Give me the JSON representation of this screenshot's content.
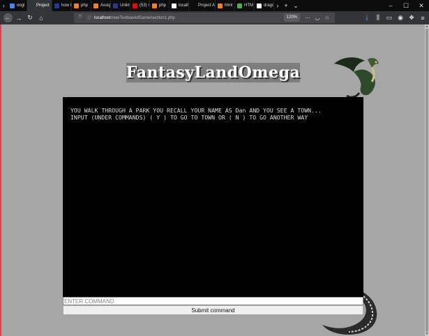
{
  "browser": {
    "tabs": [
      {
        "label": "oogl",
        "favicon_color": "#4285f4",
        "active": false
      },
      {
        "label": "Project",
        "favicon_color": "#323639",
        "active": true
      },
      {
        "label": "how t",
        "favicon_color": "#1f3a93",
        "active": false
      },
      {
        "label": "php",
        "favicon_color": "#f48024",
        "active": false
      },
      {
        "label": "Assig",
        "favicon_color": "#f48024",
        "active": false
      },
      {
        "label": "Unlim",
        "favicon_color": "#2a3b8f",
        "active": false
      },
      {
        "label": "(53) s",
        "favicon_color": "#ff0000",
        "active": false
      },
      {
        "label": "php",
        "favicon_color": "#f48024",
        "active": false
      },
      {
        "label": "localh",
        "favicon_color": "#ffffff",
        "active": false
      },
      {
        "label": "Project Ap",
        "favicon_color": "#0c0c0d",
        "active": false
      },
      {
        "label": "html",
        "favicon_color": "#f48024",
        "active": false
      },
      {
        "label": "HTM",
        "favicon_color": "#4caf50",
        "active": false
      },
      {
        "label": "drago",
        "favicon_color": "#ffffff",
        "active": false
      }
    ],
    "new_tab_icon": "plus-icon",
    "url_host": "localhost",
    "url_path": "/newTextbasedGame/section1.php",
    "zoom": "120%"
  },
  "page": {
    "site_title": "FantasyLandOmega",
    "game_lines": [
      "YOU WALK THROUGH A PARK YOU RECALL YOUR NAME AS Dan AND YOU SEE A TOWN...",
      "INPUT (UNDER COMMANDS) ( Y ) TO GO TO TOWN OR ( N ) TO GO ANOTHER WAY"
    ],
    "command_placeholder": "ENTER COMMAND",
    "submit_label": "Submit command"
  }
}
